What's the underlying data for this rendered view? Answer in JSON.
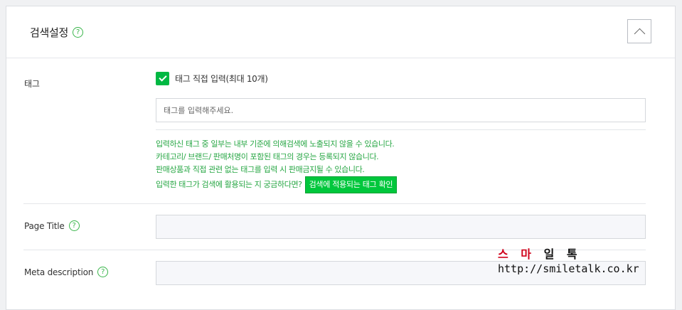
{
  "section": {
    "title": "검색설정",
    "help_icon": "question-circle-icon",
    "collapse_icon": "chevron-up-icon"
  },
  "tag": {
    "label": "태그",
    "checkbox_label": "태그 직접 입력(최대 10개)",
    "checkbox_checked": true,
    "input_placeholder": "태그를 입력해주세요.",
    "notes": [
      "입력하신 태그 중 일부는 내부 기준에 의해검색에 노출되지 않을 수 있습니다.",
      "카테고리/ 브랜드/ 판매처명이 포함된 태그의 경우는 등록되지 않습니다.",
      "판매상품과 직접 관련 없는 태그를 입력 시 판매금지될 수 있습니다.",
      "입력한 태그가 검색에 활용되는 지 궁금하다면?"
    ],
    "check_button": "검색에 적용되는 태그 확인"
  },
  "page_title": {
    "label": "Page Title",
    "value": ""
  },
  "meta_description": {
    "label": "Meta description",
    "value": ""
  },
  "watermark": {
    "part1": "스 마",
    "part2": " 일 톡",
    "url": "http://smiletalk.co.kr"
  },
  "colors": {
    "accent_green": "#00c73c",
    "note_green": "#28a745",
    "watermark_red": "#d0021b"
  }
}
